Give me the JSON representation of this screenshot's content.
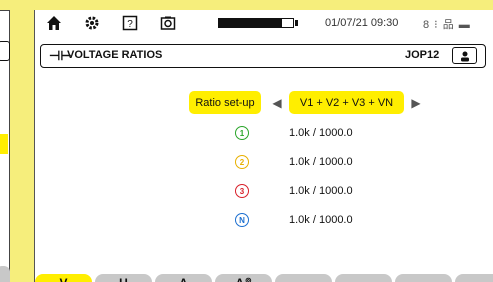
{
  "status_bar": {
    "icons": [
      "home-icon",
      "settings-gear-icon",
      "help-icon",
      "camera-icon"
    ],
    "battery_level": 0.85,
    "datetime": "01/07/21 09:30",
    "right_icons_text": "8 ⁝ 品 ▬"
  },
  "title_bar": {
    "icon_glyph": "⊣⊢",
    "title": "VOLTAGE RATIOS",
    "code": "JOP12",
    "user_icon": "user-icon"
  },
  "ratio_setup": {
    "label": "Ratio set-up",
    "left_arrow": "◀",
    "right_arrow": "▶",
    "value": "V1 + V2 + V3 + VN"
  },
  "phases": [
    {
      "symbol": "1",
      "value": "1.0k / 1000.0",
      "color": "#2aa52a"
    },
    {
      "symbol": "2",
      "value": "1.0k / 1000.0",
      "color": "#e8b000"
    },
    {
      "symbol": "3",
      "value": "1.0k / 1000.0",
      "color": "#d8202a"
    },
    {
      "symbol": "N",
      "value": "1.0k / 1000.0",
      "color": "#1c6fd0"
    }
  ],
  "tabs": [
    "V",
    "U",
    "A",
    "A",
    "",
    "",
    "",
    ""
  ],
  "colors": {
    "accent_yellow": "#ffee00",
    "background": "#f6ee7c",
    "tab_gray": "#c8c8c8"
  }
}
